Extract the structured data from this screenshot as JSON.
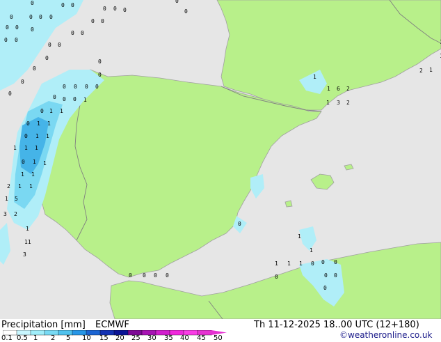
{
  "map": {
    "sea_color": "#e6e6e6",
    "land_color": "#b8f08a",
    "border_color": "#808080",
    "coast_color": "#a0a0a0",
    "precip_light": "#b0eef8",
    "precip_mid": "#7ad8f2",
    "precip_heavy": "#45b4e8",
    "grid_values": [
      "0",
      "0",
      "0",
      "0",
      "0",
      "0",
      "0",
      "0",
      "0",
      "0",
      "0",
      "0",
      "0",
      "0",
      "0",
      "0",
      "0",
      "0",
      "0",
      "0",
      "0",
      "0",
      "0",
      "0",
      "0",
      "0",
      "0",
      "0",
      "0",
      "0",
      "0",
      "0",
      "0",
      "0",
      "0",
      "0",
      "1",
      "0",
      "1",
      "1",
      "0",
      "1",
      "1",
      "0",
      "1",
      "1",
      "1",
      "1",
      "1",
      "0",
      "1",
      "1",
      "1",
      "1",
      "2",
      "1",
      "1",
      "1",
      "5",
      "3",
      "2",
      "1",
      "11",
      "3",
      "1",
      "1",
      "6",
      "2",
      "1",
      "3",
      "2",
      "2",
      "1",
      "1",
      "1",
      "1",
      "1",
      "1",
      "1",
      "1",
      "0",
      "0",
      "0",
      "0",
      "0",
      "0",
      "0",
      "0",
      "0",
      "0",
      "0",
      "0",
      "0",
      "0",
      "0",
      "0",
      "0",
      "0",
      "0",
      "0",
      "0",
      "0",
      "0",
      "0",
      "0",
      "2",
      "0",
      "0",
      "0",
      "0",
      "0",
      "0",
      "0",
      "0",
      "2",
      "0",
      "0",
      "0",
      "0",
      "0",
      "0",
      "0",
      "0",
      "0",
      "0",
      "0",
      "0",
      "0",
      "0",
      "0"
    ]
  },
  "footer": {
    "title": "Precipitation [mm]",
    "model": "ECMWF",
    "datetime": "Th 11-12-2025 18..00 UTC (12+180)",
    "credit": "©weatheronline.co.uk"
  },
  "legend": {
    "ticks": [
      "0.1",
      "0.5",
      "1",
      "2",
      "5",
      "10",
      "15",
      "20",
      "25",
      "30",
      "35",
      "40",
      "45",
      "50"
    ],
    "colors": [
      "#ffffff",
      "#c8f6fe",
      "#a0eefa",
      "#78daf4",
      "#50c2ee",
      "#2896e6",
      "#1c64d2",
      "#1432b4",
      "#0a1496",
      "#7e0a96",
      "#a814b4",
      "#d21ece",
      "#f028dc",
      "#fa3ce6",
      "#e632d2"
    ]
  }
}
